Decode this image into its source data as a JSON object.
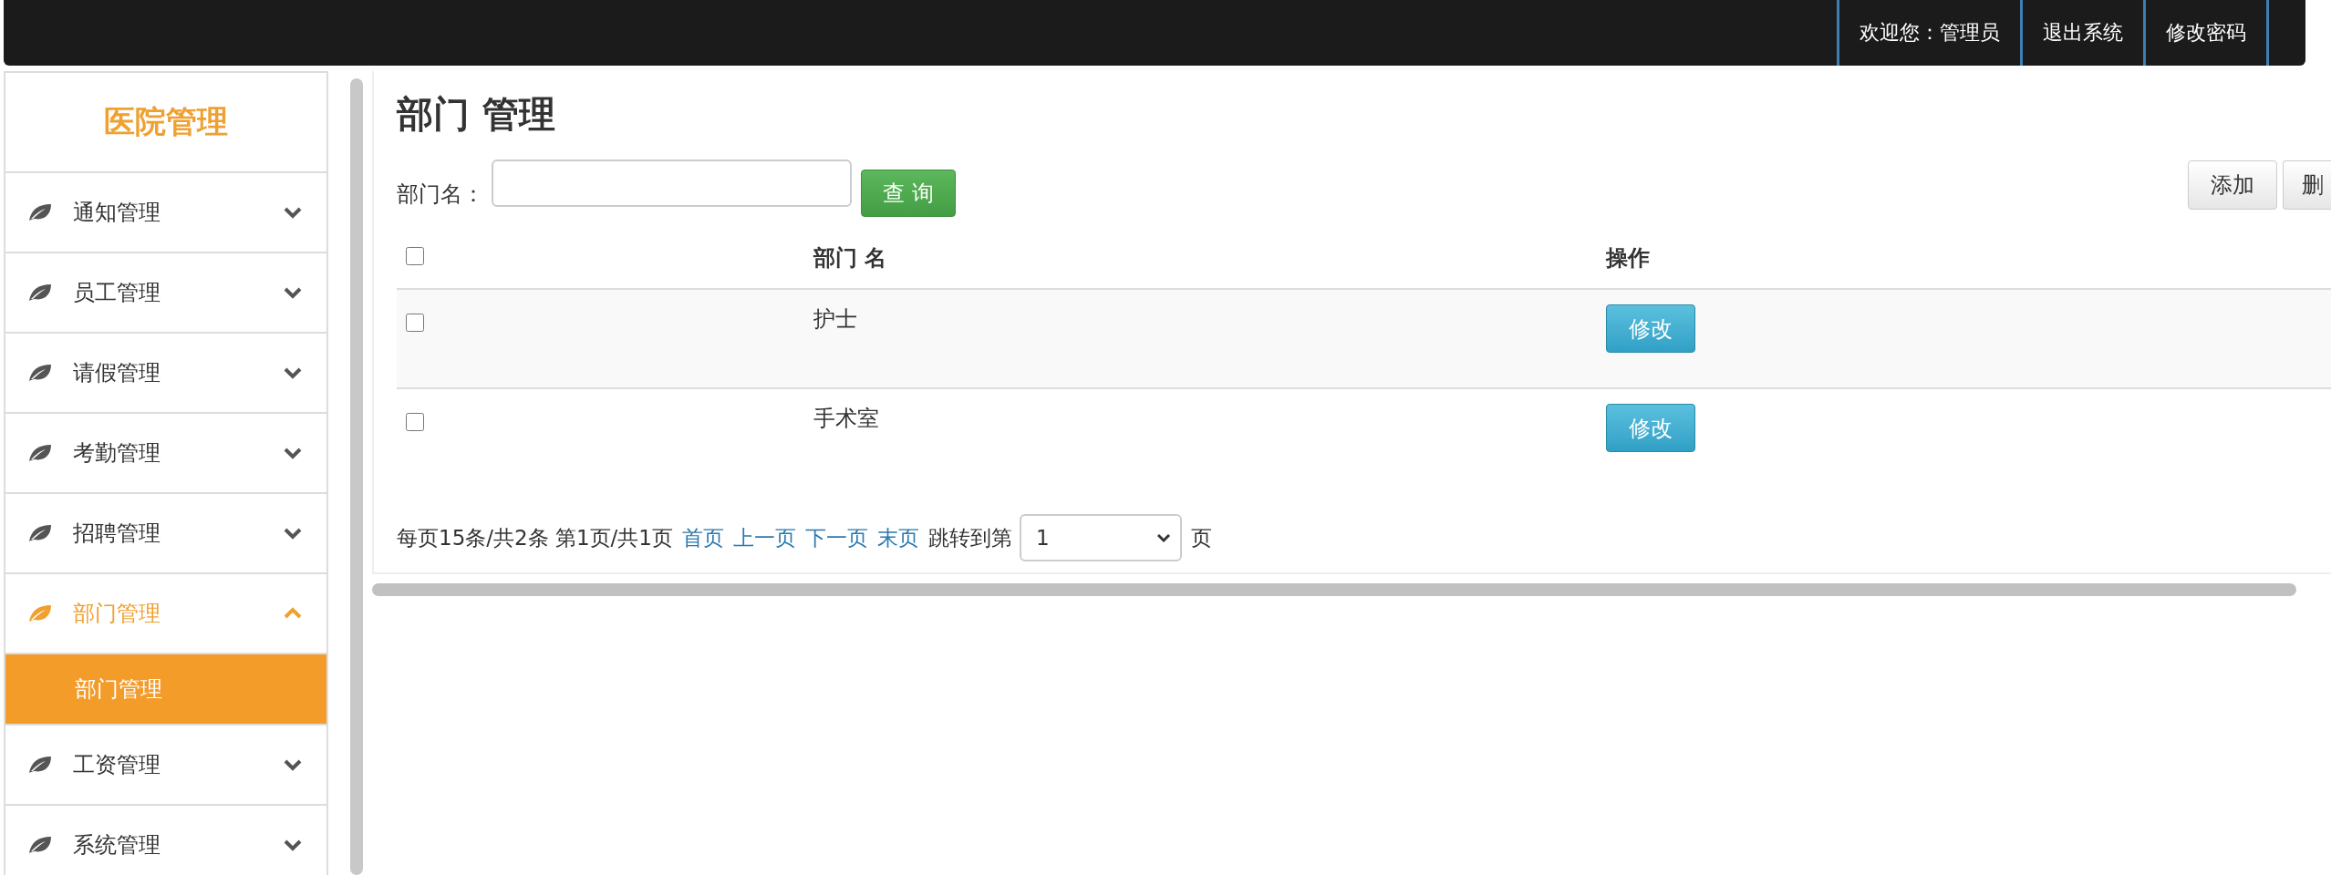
{
  "top_bar": {
    "links": [
      {
        "label": "欢迎您：管理员"
      },
      {
        "label": "退出系统"
      },
      {
        "label": "修改密码"
      }
    ]
  },
  "sidebar": {
    "title": "医院管理",
    "items": [
      {
        "label": "通知管理",
        "expanded": false
      },
      {
        "label": "员工管理",
        "expanded": false
      },
      {
        "label": "请假管理",
        "expanded": false
      },
      {
        "label": "考勤管理",
        "expanded": false
      },
      {
        "label": "招聘管理",
        "expanded": false
      },
      {
        "label": "部门管理",
        "expanded": true,
        "children": [
          {
            "label": "部门管理",
            "selected": true
          }
        ]
      },
      {
        "label": "工资管理",
        "expanded": false
      },
      {
        "label": "系统管理",
        "expanded": false
      }
    ]
  },
  "main": {
    "title": "部门 管理",
    "search": {
      "label": "部门名："
    },
    "search_button": "查 询",
    "toolbar_buttons": [
      "添加",
      "删"
    ],
    "table": {
      "header_checked": false,
      "columns": [
        "部门 名",
        "操作"
      ],
      "rows": [
        {
          "checked": false,
          "name": "护士",
          "action": "修改"
        },
        {
          "checked": false,
          "name": "手术室",
          "action": "修改"
        }
      ]
    },
    "pagination": {
      "summary": "每页15条/共2条 第1页/共1页",
      "links": [
        "首页",
        "上一页",
        "下一页",
        "末页"
      ],
      "jump_label": "跳转到第",
      "page": "1",
      "suffix": "页"
    }
  }
}
